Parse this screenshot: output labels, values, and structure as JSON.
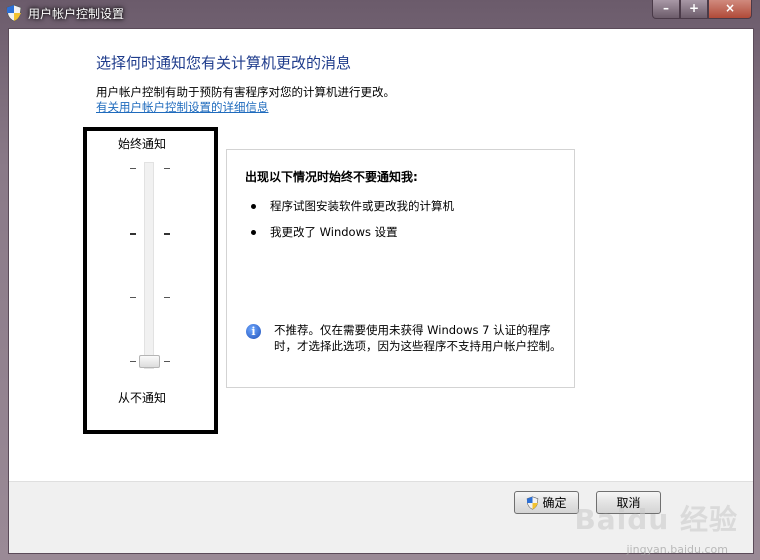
{
  "window": {
    "title": "用户帐户控制设置",
    "controls": [
      "–",
      "+",
      "×"
    ]
  },
  "header": {
    "heading": "选择何时通知您有关计算机更改的消息",
    "description": "用户帐户控制有助于预防有害程序对您的计算机进行更改。",
    "help_link": "有关用户帐户控制设置的详细信息"
  },
  "slider": {
    "top_label": "始终通知",
    "bottom_label": "从不通知",
    "level": 0,
    "levels": 4
  },
  "info": {
    "heading": "出现以下情况时始终不要通知我:",
    "bullets": [
      "程序试图安装软件或更改我的计算机",
      "我更改了 Windows 设置"
    ],
    "note": "不推荐。仅在需要使用未获得 Windows 7 认证的程序时，才选择此选项，因为这些程序不支持用户帐户控制。"
  },
  "footer": {
    "ok_label": "确定",
    "cancel_label": "取消"
  },
  "watermark": {
    "text": "Baidu 经验",
    "sub": "jingyan.baidu.com"
  },
  "colors": {
    "heading": "#1f3c8c",
    "link": "#1f6bbd"
  }
}
